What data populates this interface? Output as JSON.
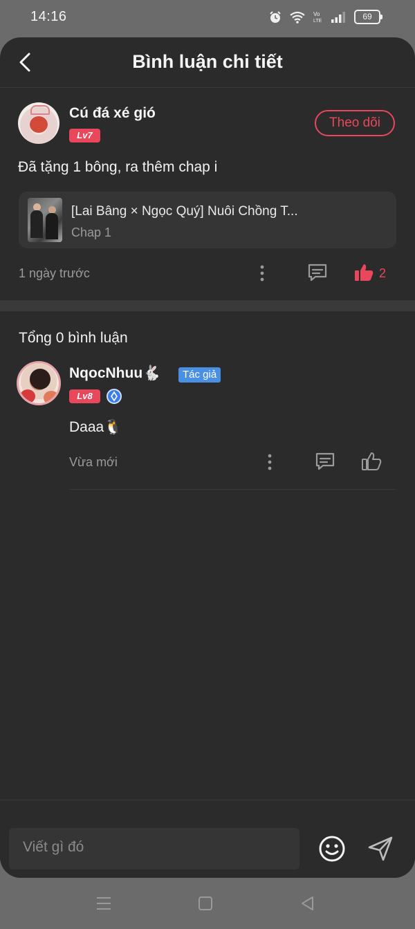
{
  "status_bar": {
    "time": "14:16",
    "battery": "69",
    "network_label": "Vo LTE"
  },
  "header": {
    "title": "Bình luận chi tiết"
  },
  "post": {
    "username": "Cú đá xé gió",
    "level": "Lv7",
    "follow_label": "Theo dõi",
    "text": "Đã tặng 1 bông, ra thêm chap i",
    "chapter": {
      "title": "[Lai Bâng × Ngọc Quý] Nuôi Chồng T...",
      "subtitle": "Chap 1"
    },
    "time": "1 ngày trước",
    "like_count": "2"
  },
  "comments_section": {
    "total_label": "Tổng 0 bình luận",
    "comments": [
      {
        "username": "NqocNhuu🐇",
        "author_tag": "Tác giả",
        "level": "Lv8",
        "text": "Daaa🐧",
        "time": "Vừa mới"
      }
    ]
  },
  "input": {
    "placeholder": "Viết gì đó"
  },
  "colors": {
    "accent": "#e8475c",
    "author_tag": "#4a90e2",
    "background": "#2b2b2b"
  }
}
